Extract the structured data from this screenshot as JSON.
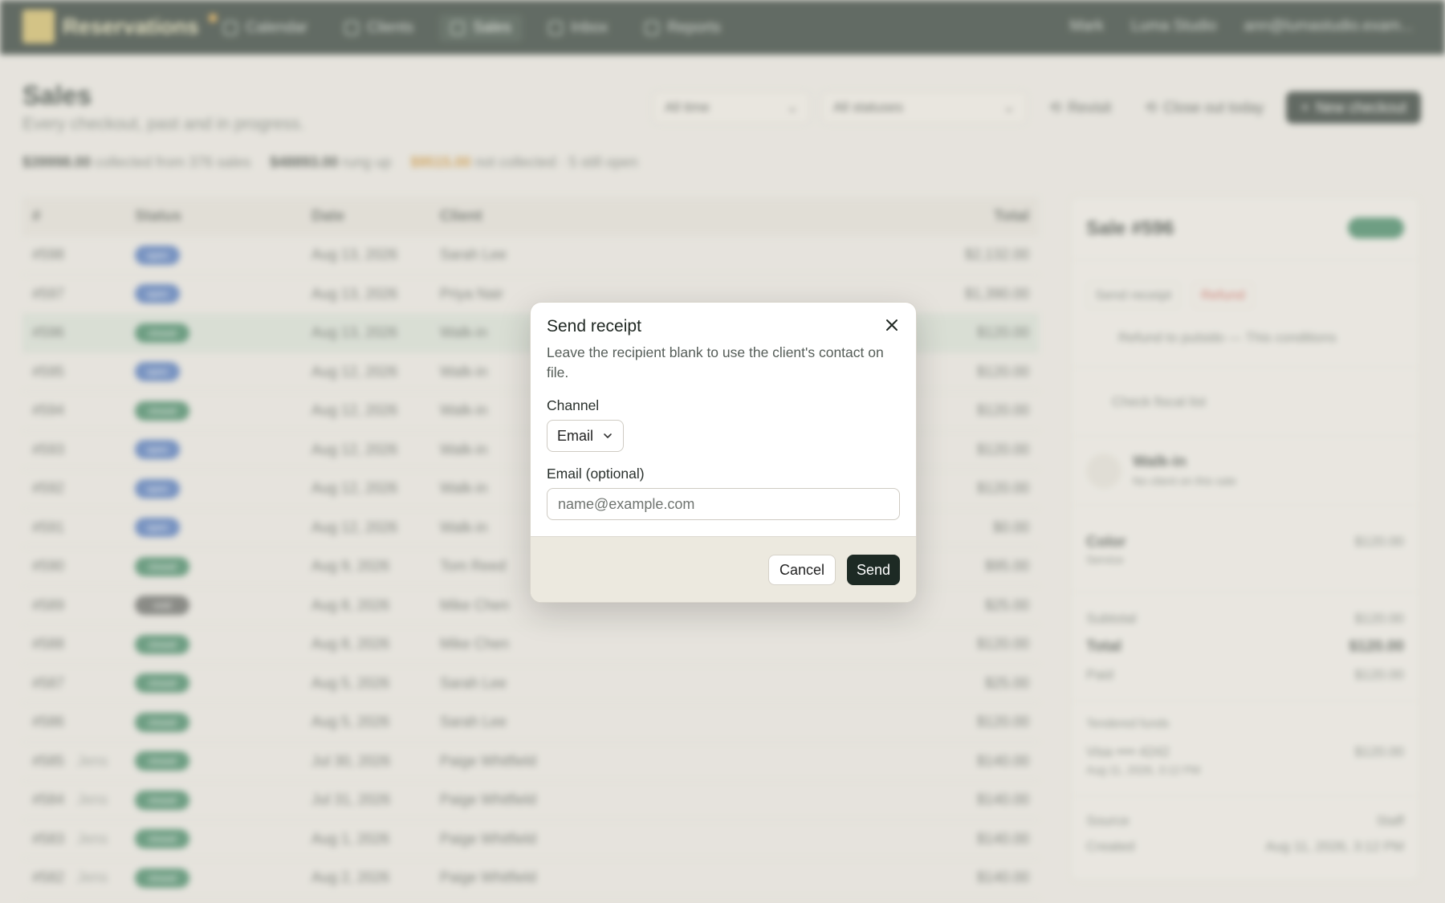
{
  "nav": {
    "brand": "Reservations",
    "items": [
      {
        "label": "Calendar"
      },
      {
        "label": "Clients"
      },
      {
        "label": "Sales"
      },
      {
        "label": "Inbox"
      },
      {
        "label": "Reports"
      }
    ],
    "right": [
      "Mark",
      "Luma Studio",
      "ann@lumastudio.exam..."
    ]
  },
  "page": {
    "title": "Sales",
    "subtitle": "Every checkout, past and in progress.",
    "filters": {
      "time": "All time",
      "status": "All statuses"
    },
    "actions": {
      "revisit": "Revisit",
      "close_out": "Close out today",
      "new_checkout": "New checkout"
    },
    "stats": {
      "collected_amount": "$39998.00",
      "collected_text": "collected from 376 sales",
      "rung_amount": "$48893.00",
      "rung_text": "rung up",
      "uncollected_amount": "$9515.00",
      "uncollected_text": "not collected · 5 still open"
    }
  },
  "table": {
    "headers": {
      "id": "#",
      "status": "Status",
      "date": "Date",
      "client": "Client",
      "total": "Total"
    },
    "rows": [
      {
        "id": "#598",
        "tag": "",
        "status": "open",
        "date": "Aug 13, 2026",
        "client": "Sarah Lee",
        "total": "$2,132.00"
      },
      {
        "id": "#597",
        "tag": "",
        "status": "open",
        "date": "Aug 13, 2026",
        "client": "Priya Nair",
        "total": "$1,390.00"
      },
      {
        "id": "#596",
        "tag": "",
        "status": "closed",
        "date": "Aug 13, 2026",
        "client": "Walk-in",
        "total": "$120.00"
      },
      {
        "id": "#595",
        "tag": "",
        "status": "open",
        "date": "Aug 12, 2026",
        "client": "Walk-in",
        "total": "$120.00"
      },
      {
        "id": "#594",
        "tag": "",
        "status": "closed",
        "date": "Aug 12, 2026",
        "client": "Walk-in",
        "total": "$120.00"
      },
      {
        "id": "#593",
        "tag": "",
        "status": "open",
        "date": "Aug 12, 2026",
        "client": "Walk-in",
        "total": "$120.00"
      },
      {
        "id": "#592",
        "tag": "",
        "status": "open",
        "date": "Aug 12, 2026",
        "client": "Walk-in",
        "total": "$120.00"
      },
      {
        "id": "#591",
        "tag": "",
        "status": "open",
        "date": "Aug 12, 2026",
        "client": "Walk-in",
        "total": "$0.00"
      },
      {
        "id": "#590",
        "tag": "",
        "status": "closed",
        "date": "Aug 9, 2026",
        "client": "Tom Reed",
        "total": "$95.00"
      },
      {
        "id": "#589",
        "tag": "",
        "status": "void",
        "date": "Aug 8, 2026",
        "client": "Mike Chen",
        "total": "$25.00"
      },
      {
        "id": "#588",
        "tag": "",
        "status": "closed",
        "date": "Aug 8, 2026",
        "client": "Mike Chen",
        "total": "$120.00"
      },
      {
        "id": "#587",
        "tag": "",
        "status": "closed",
        "date": "Aug 5, 2026",
        "client": "Sarah Lee",
        "total": "$25.00"
      },
      {
        "id": "#586",
        "tag": "",
        "status": "closed",
        "date": "Aug 5, 2026",
        "client": "Sarah Lee",
        "total": "$120.00"
      },
      {
        "id": "#585",
        "tag": "Jens",
        "status": "closed",
        "date": "Jul 30, 2026",
        "client": "Paige Whitfield",
        "total": "$140.00"
      },
      {
        "id": "#584",
        "tag": "Jens",
        "status": "closed",
        "date": "Jul 31, 2026",
        "client": "Paige Whitfield",
        "total": "$140.00"
      },
      {
        "id": "#583",
        "tag": "Jens",
        "status": "closed",
        "date": "Aug 1, 2026",
        "client": "Paige Whitfield",
        "total": "$140.00"
      },
      {
        "id": "#582",
        "tag": "Jens",
        "status": "closed",
        "date": "Aug 2, 2026",
        "client": "Paige Whitfield",
        "total": "$140.00"
      }
    ]
  },
  "side": {
    "title": "Sale #596",
    "send_receipt": "Send receipt",
    "refund": "Refund",
    "refund_note": "Refund to pulsido — This conditions",
    "check_fiscal": "Check fiscal list",
    "client_name": "Walk-in",
    "client_sub": "No client on this sale",
    "item_name": "Color",
    "item_sub": "Service",
    "item_price": "$120.00",
    "subtotal_label": "Subtotal",
    "subtotal": "$120.00",
    "total_label": "Total",
    "total": "$120.00",
    "paid_label": "Paid",
    "paid": "$120.00",
    "tendered_label": "Tendered funds",
    "tender_card": "Visa •••• 4242",
    "tender_date": "Aug 11, 2026, 3:12 PM",
    "tender_amount": "$120.00",
    "source_label": "Source",
    "source_value": "Staff",
    "created_label": "Created",
    "created_value": "Aug 11, 2026, 3:12 PM"
  },
  "modal": {
    "title": "Send receipt",
    "description": "Leave the recipient blank to use the client's contact on file.",
    "channel_label": "Channel",
    "channel_value": "Email",
    "email_label": "Email (optional)",
    "email_placeholder": "name@example.com",
    "email_value": "",
    "cancel_label": "Cancel",
    "send_label": "Send"
  }
}
